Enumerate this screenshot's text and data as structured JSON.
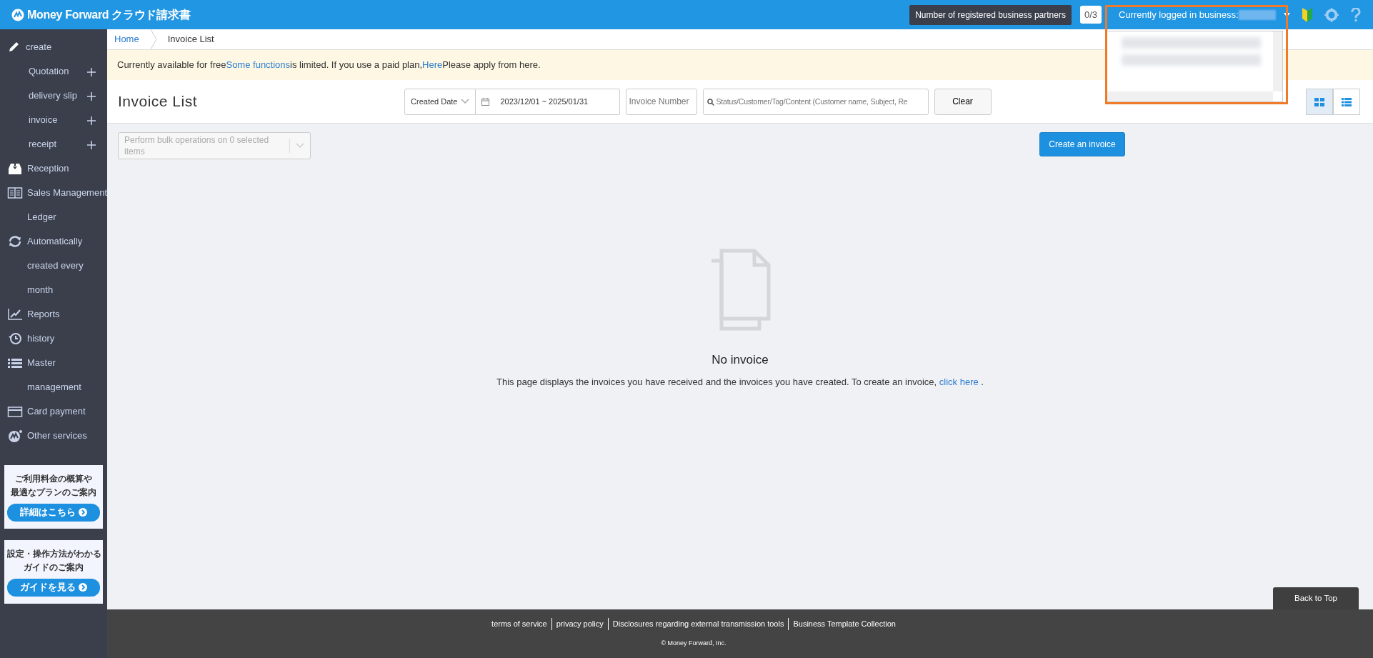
{
  "header": {
    "brand": "Money Forward",
    "product": "クラウド請求書",
    "partners_tooltip": "Number of registered business partners",
    "partners_count": "0/3",
    "business_label": "Currently logged in business:",
    "highlighted": true,
    "menu_expanded": true
  },
  "breadcrumb": [
    {
      "label": "Home",
      "kind": "link"
    },
    {
      "label": "Invoice List",
      "kind": "current"
    }
  ],
  "notice": [
    {
      "text": "Currently available for free",
      "kind": "text"
    },
    {
      "text": "Some functions",
      "kind": "link"
    },
    {
      "text": "is limited. If you use a paid plan,",
      "kind": "text"
    },
    {
      "text": "Here",
      "kind": "link"
    },
    {
      "text": "Please apply from here.",
      "kind": "text"
    }
  ],
  "sidebar": {
    "items": [
      {
        "kind": "section",
        "label": "create"
      },
      {
        "kind": "sub",
        "label": "Quotation"
      },
      {
        "kind": "sub",
        "label": "delivery slip"
      },
      {
        "kind": "sub",
        "label": "invoice"
      },
      {
        "kind": "sub",
        "label": "receipt"
      },
      {
        "kind": "main",
        "label": "Reception"
      },
      {
        "kind": "main",
        "label": "Sales Management Ledger"
      },
      {
        "kind": "main",
        "label": "Automatically created every month"
      },
      {
        "kind": "main",
        "label": "Reports"
      },
      {
        "kind": "main",
        "label": "history"
      },
      {
        "kind": "main",
        "label": "Master management"
      },
      {
        "kind": "main",
        "label": "Card payment"
      },
      {
        "kind": "main",
        "label": "Other services"
      }
    ],
    "banners": [
      {
        "lines": [
          "ご利用料金の概算や",
          "最適なプランのご案内"
        ],
        "button": "詳細はこちら"
      },
      {
        "lines": [
          "設定・操作方法がわかる",
          "ガイドのご案内"
        ],
        "button": "ガイドを見る"
      }
    ]
  },
  "toolbar": {
    "title": "Invoice List",
    "date_field": "Created Date",
    "date_from": "2023/12/01",
    "date_separator": "~",
    "date_to": "2025/01/31",
    "number_placeholder": "Invoice Number",
    "search_placeholder": "Status/Customer/Tag/Content (Customer name, Subject, Re",
    "clear": "Clear",
    "views": [
      {
        "selected": true
      },
      {
        "selected": false
      }
    ]
  },
  "bulk": {
    "placeholder": "Perform bulk operations on 0 selected items",
    "disabled": true
  },
  "create_button": "Create an invoice",
  "empty": {
    "title": "No invoice",
    "text": "This page displays the invoices you have received and the invoices you have created. To create an invoice,",
    "link": "click here",
    "tail": "."
  },
  "back_to_top": "Back to Top",
  "footer": {
    "links": [
      "terms of service",
      "privacy policy",
      "Disclosures regarding external transmission tools",
      "Business Template Collection"
    ],
    "copyright": "© Money Forward, Inc."
  }
}
